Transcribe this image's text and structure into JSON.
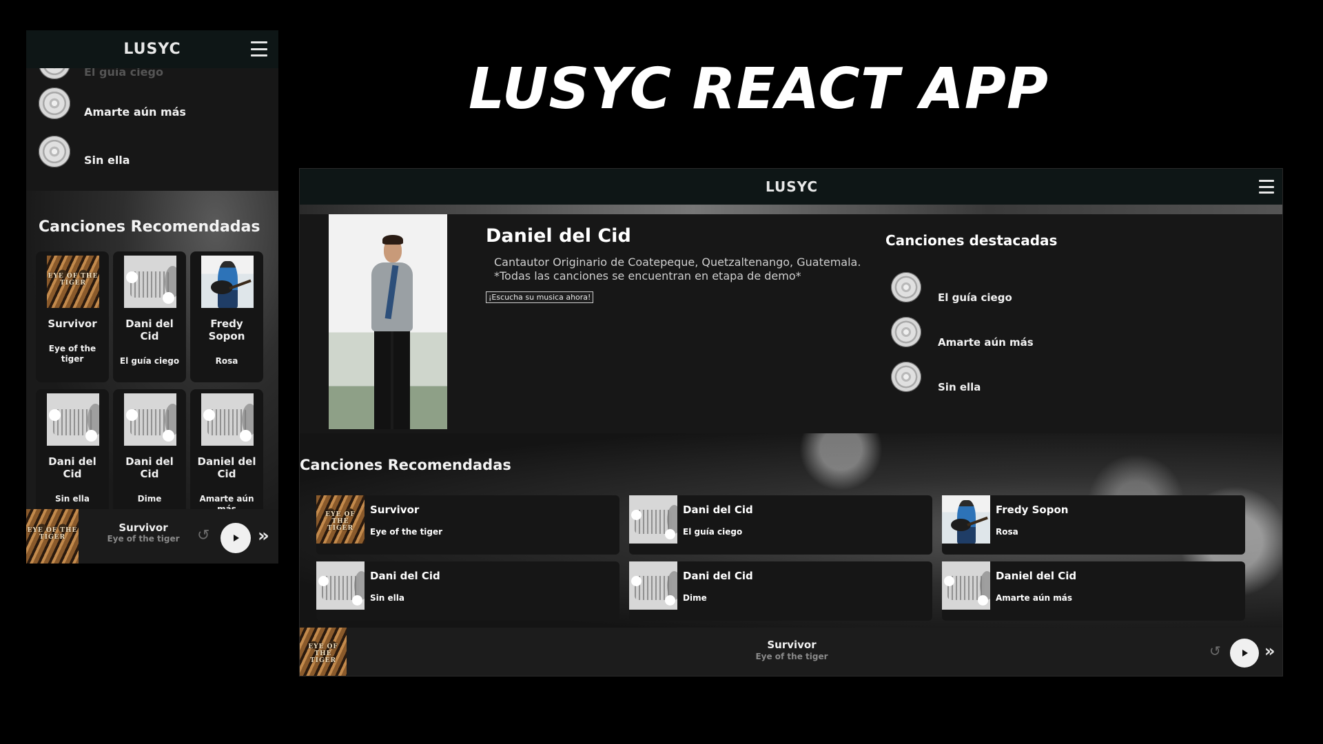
{
  "headline": "LUSYC REACT APP",
  "mobile": {
    "logo": "LUSYC",
    "featured": [
      {
        "label": "El guía ciego"
      },
      {
        "label": "Amarte aún más"
      },
      {
        "label": "Sin ella"
      }
    ],
    "recommended_title": "Canciones Recomendadas",
    "cards": [
      {
        "artist": "Survivor",
        "song": "Eye of the tiger",
        "cover": "tiger"
      },
      {
        "artist": "Dani del Cid",
        "song": "El guía ciego",
        "cover": "disc"
      },
      {
        "artist": "Fredy Sopon",
        "song": "Rosa",
        "cover": "guitar"
      },
      {
        "artist": "Dani del Cid",
        "song": "Sin ella",
        "cover": "disc"
      },
      {
        "artist": "Dani del Cid",
        "song": "Dime",
        "cover": "disc"
      },
      {
        "artist": "Daniel del Cid",
        "song": "Amarte aún más",
        "cover": "disc"
      }
    ],
    "player": {
      "title": "Survivor",
      "subtitle": "Eye of the tiger"
    }
  },
  "desktop": {
    "logo": "LUSYC",
    "artist": {
      "name": "Daniel del Cid",
      "desc1": "Cantautor Originario de Coatepeque, Quetzaltenango, Guatemala.",
      "desc2": "*Todas las canciones se encuentran en etapa de demo*",
      "listen_label": "¡Escucha su musica ahora!"
    },
    "featured_title": "Canciones destacadas",
    "featured": [
      {
        "label": "El guía ciego"
      },
      {
        "label": "Amarte aún más"
      },
      {
        "label": "Sin ella"
      }
    ],
    "recommended_title": "Canciones Recomendadas",
    "cards": [
      {
        "artist": "Survivor",
        "song": "Eye of the tiger",
        "cover": "tiger"
      },
      {
        "artist": "Dani del Cid",
        "song": "El guía ciego",
        "cover": "disc"
      },
      {
        "artist": "Fredy Sopon",
        "song": "Rosa",
        "cover": "guitar"
      },
      {
        "artist": "Dani del Cid",
        "song": "Sin ella",
        "cover": "disc"
      },
      {
        "artist": "Dani del Cid",
        "song": "Dime",
        "cover": "disc"
      },
      {
        "artist": "Daniel del Cid",
        "song": "Amarte aún más",
        "cover": "disc"
      }
    ],
    "player": {
      "title": "Survivor",
      "subtitle": "Eye of the tiger"
    }
  },
  "icons": {
    "menu": "hamburger-icon",
    "repeat": "repeat-icon",
    "play": "play-icon",
    "next": "next-icon",
    "disc": "disc-icon"
  },
  "colors": {
    "background": "#000000",
    "panel": "#171717",
    "header": "#0e1616",
    "text": "#ffffff",
    "muted": "#8a8a8a"
  }
}
